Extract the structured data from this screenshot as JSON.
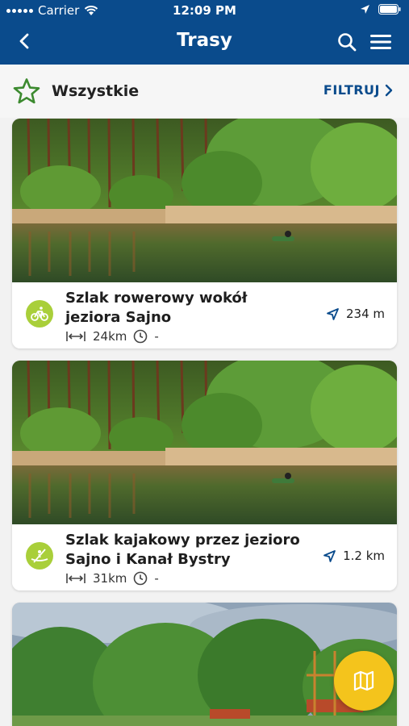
{
  "status_bar": {
    "carrier": "Carrier",
    "time": "12:09 PM"
  },
  "nav": {
    "title": "Trasy"
  },
  "filter_bar": {
    "category": "Wszystkie",
    "filter_label": "FILTRUJ"
  },
  "routes": [
    {
      "name_line1": "Szlak rowerowy wokół",
      "name_line2": "jeziora Sajno",
      "length": "24km",
      "duration": "-",
      "distance": "234 m",
      "activity_icon": "bicycle-icon"
    },
    {
      "name_line1": "Szlak kajakowy przez jezioro",
      "name_line2": "Sajno i Kanał Bystry",
      "length": "31km",
      "duration": "-",
      "distance": "1.2 km",
      "activity_icon": "kayak-icon"
    }
  ],
  "colors": {
    "header_bg": "#0a4b8c",
    "accent_green": "#a9cf3a",
    "fab": "#f4c41c",
    "star": "#3c8a2f"
  }
}
